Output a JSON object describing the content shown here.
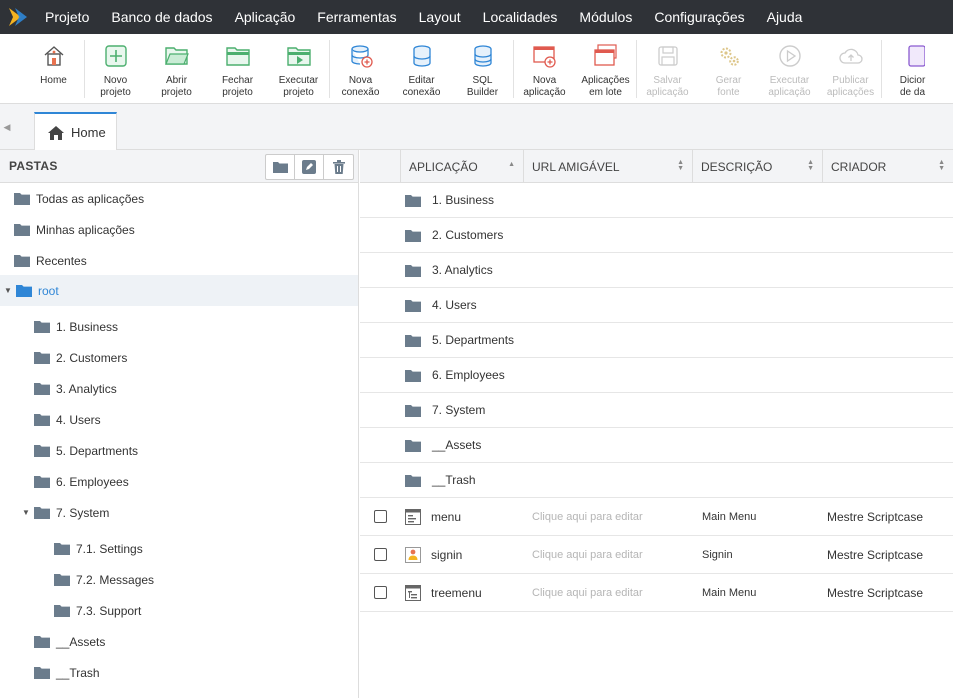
{
  "menubar": {
    "items": [
      "Projeto",
      "Banco de dados",
      "Aplicação",
      "Ferramentas",
      "Layout",
      "Localidades",
      "Módulos",
      "Configurações",
      "Ajuda"
    ]
  },
  "toolbar": {
    "groups": [
      [
        {
          "label1": "Home",
          "label2": "",
          "icon": "home-icon",
          "disabled": false
        }
      ],
      [
        {
          "label1": "Novo",
          "label2": "projeto",
          "icon": "plus-square-icon",
          "disabled": false
        },
        {
          "label1": "Abrir",
          "label2": "projeto",
          "icon": "folder-open-icon",
          "disabled": false
        },
        {
          "label1": "Fechar",
          "label2": "projeto",
          "icon": "folder-close-icon",
          "disabled": false
        },
        {
          "label1": "Executar",
          "label2": "projeto",
          "icon": "folder-run-icon",
          "disabled": false
        }
      ],
      [
        {
          "label1": "Nova",
          "label2": "conexão",
          "icon": "database-plus-icon",
          "disabled": false
        },
        {
          "label1": "Editar",
          "label2": "conexão",
          "icon": "database-edit-icon",
          "disabled": false
        },
        {
          "label1": "SQL",
          "label2": "Builder",
          "icon": "database-sql-icon",
          "disabled": false
        }
      ],
      [
        {
          "label1": "Nova",
          "label2": "aplicação",
          "icon": "window-plus-icon",
          "disabled": false
        },
        {
          "label1": "Aplicações",
          "label2": "em lote",
          "icon": "windows-stack-icon",
          "disabled": false
        }
      ],
      [
        {
          "label1": "Salvar",
          "label2": "aplicação",
          "icon": "save-icon",
          "disabled": true
        },
        {
          "label1": "Gerar",
          "label2": "fonte",
          "icon": "gears-icon",
          "disabled": true
        },
        {
          "label1": "Executar",
          "label2": "aplicação",
          "icon": "play-circle-icon",
          "disabled": true
        },
        {
          "label1": "Publicar",
          "label2": "aplicações",
          "icon": "cloud-upload-icon",
          "disabled": true
        }
      ],
      [
        {
          "label1": "Dicior",
          "label2": "de da",
          "icon": "dictionary-icon",
          "disabled": false
        }
      ]
    ]
  },
  "tabs": [
    {
      "label": "Home"
    }
  ],
  "folders_panel": {
    "title": "PASTAS",
    "items": [
      {
        "label": "Todas as aplicações",
        "level": 0,
        "caret": "",
        "selected": false
      },
      {
        "label": "Minhas aplicações",
        "level": 0,
        "caret": "",
        "selected": false
      },
      {
        "label": "Recentes",
        "level": 0,
        "caret": "",
        "selected": false
      },
      {
        "label": "root",
        "level": 0,
        "caret": "down",
        "selected": true
      },
      {
        "label": "1. Business",
        "level": 1,
        "caret": "",
        "selected": false
      },
      {
        "label": "2. Customers",
        "level": 1,
        "caret": "",
        "selected": false
      },
      {
        "label": "3. Analytics",
        "level": 1,
        "caret": "",
        "selected": false
      },
      {
        "label": "4. Users",
        "level": 1,
        "caret": "",
        "selected": false
      },
      {
        "label": "5. Departments",
        "level": 1,
        "caret": "",
        "selected": false
      },
      {
        "label": "6. Employees",
        "level": 1,
        "caret": "",
        "selected": false
      },
      {
        "label": "7. System",
        "level": 1,
        "caret": "down",
        "selected": false
      },
      {
        "label": "7.1. Settings",
        "level": 2,
        "caret": "",
        "selected": false
      },
      {
        "label": "7.2. Messages",
        "level": 2,
        "caret": "",
        "selected": false
      },
      {
        "label": "7.3. Support",
        "level": 2,
        "caret": "",
        "selected": false
      },
      {
        "label": "__Assets",
        "level": 1,
        "caret": "",
        "selected": false
      },
      {
        "label": "__Trash",
        "level": 1,
        "caret": "",
        "selected": false
      }
    ]
  },
  "table": {
    "columns": [
      "APLICAÇÃO",
      "URL AMIGÁVEL",
      "DESCRIÇÃO",
      "CRIADOR"
    ],
    "folder_rows": [
      "1. Business",
      "2. Customers",
      "3. Analytics",
      "4. Users",
      "5. Departments",
      "6. Employees",
      "7. System",
      "__Assets",
      "__Trash"
    ],
    "app_rows": [
      {
        "name": "menu",
        "url": "Clique aqui para editar",
        "description": "Main Menu",
        "creator": "Mestre Scriptcase",
        "icon": "menu-app-icon"
      },
      {
        "name": "signin",
        "url": "Clique aqui para editar",
        "description": "Signin",
        "creator": "Mestre Scriptcase",
        "icon": "signin-app-icon"
      },
      {
        "name": "treemenu",
        "url": "Clique aqui para editar",
        "description": "Main Menu",
        "creator": "Mestre Scriptcase",
        "icon": "treemenu-app-icon"
      }
    ]
  },
  "colors": {
    "menubar_bg": "#2f3237",
    "accent": "#2f86d6",
    "folder": "#6b7c8c"
  }
}
